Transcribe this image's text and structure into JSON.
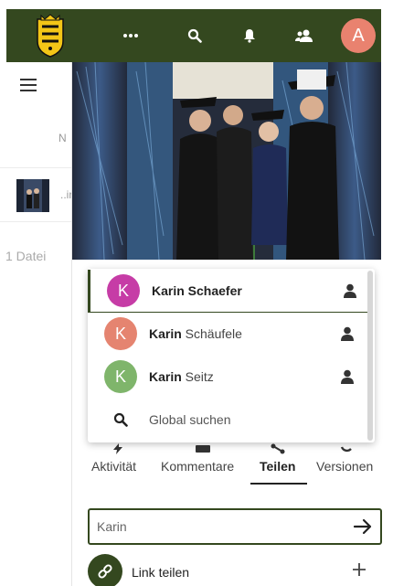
{
  "header": {
    "more_icon": "more-horizontal-icon",
    "search_icon": "search-icon",
    "bell_icon": "bell-icon",
    "contacts_icon": "contacts-icon",
    "user_initial": "A",
    "bg_color": "#34481f"
  },
  "files": {
    "clipped_letter": "N",
    "thumb_ellipsis": "..ir",
    "count": "1 Datei"
  },
  "suggestions": [
    {
      "initial": "K",
      "match": "Karin",
      "rest": " Schaefer",
      "color": "#c63ca6",
      "icon": "user-icon"
    },
    {
      "initial": "K",
      "match": "Karin",
      "rest": " Schäufele",
      "color": "#e58470",
      "icon": "user-icon"
    },
    {
      "initial": "K",
      "match": "Karin",
      "rest": " Seitz",
      "color": "#7fb56b",
      "icon": "user-icon"
    }
  ],
  "global_search": "Global suchen",
  "tabs": [
    {
      "label": "Aktivität"
    },
    {
      "label": "Kommentare"
    },
    {
      "label": "Teilen"
    },
    {
      "label": "Versionen"
    }
  ],
  "share": {
    "input_value": "Karin",
    "link_label": "Link teilen"
  }
}
